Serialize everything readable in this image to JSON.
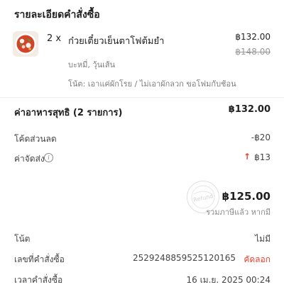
{
  "section": {
    "title": "รายละเอียดคำสั่งซื้อ"
  },
  "item": {
    "qty": "2 x",
    "name": "ก๋วยเตี๋ยวเย็นตาโฟต้มยำ",
    "price": "฿132.00",
    "original_price": "฿148.00",
    "options": "บะหมี่, วุ้นเส้น",
    "note": "โน้ต: เอาแค่ผักโรย / ไม่เอาผักลวก ขอโฟมกับช้อน"
  },
  "summary": {
    "subtotal_label": "ค่าอาหารสุทธิ (2 รายการ)",
    "subtotal_value": "฿132.00",
    "discount_label": "โค้ดส่วนลด",
    "discount_value": "-฿20",
    "delivery_label": "ค่าจัดส่ง",
    "delivery_value": "฿13",
    "total_value": "฿125.00",
    "tax_note": "รวมภาษีแล้ว หากมี",
    "stamp_text": "Refund"
  },
  "details": {
    "note_label": "โน้ต",
    "note_value": "ไม่มี",
    "order_id_label": "เลขที่คำสั่งซื้อ",
    "order_id_value": "2529248859525120165",
    "copy_label": "คัดลอก",
    "order_time_label": "เวลาคำสั่งซื้อ",
    "order_time_value": "16 เม.ย. 2025 00:24"
  },
  "icons": {
    "food": "food-thumbnail",
    "info": "info-icon",
    "arrow": "up-arrow-icon"
  },
  "colors": {
    "accent": "#e8412e",
    "muted": "#7d7d7d",
    "text": "#222222"
  }
}
